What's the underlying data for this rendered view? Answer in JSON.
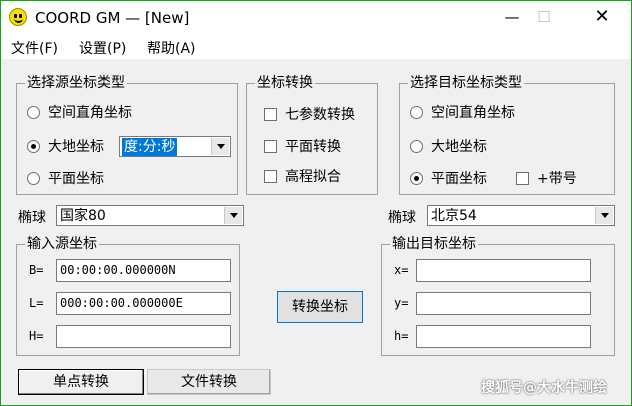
{
  "window": {
    "title": "COORD GM — [New]",
    "min": "—",
    "max": "☐",
    "close": "✕"
  },
  "menu": [
    "文件(F)",
    "设置(P)",
    "帮助(A)"
  ],
  "source_type": {
    "title": "选择源坐标类型",
    "options": [
      "空间直角坐标",
      "大地坐标",
      "平面坐标"
    ],
    "selected": "大地坐标",
    "format_value": "度:分:秒"
  },
  "conversion": {
    "title": "坐标转换",
    "options": [
      "七参数转换",
      "平面转换",
      "高程拟合"
    ]
  },
  "target_type": {
    "title": "选择目标坐标类型",
    "options": [
      "空间直角坐标",
      "大地坐标",
      "平面坐标"
    ],
    "selected": "平面坐标",
    "band_label": "+带号"
  },
  "ellipsoid": {
    "label": "椭球",
    "source_value": "国家80",
    "target_value": "北京54"
  },
  "input_coords": {
    "title": "输入源坐标",
    "labels": [
      "B=",
      "L=",
      "H="
    ],
    "values": [
      "00:00:00.000000N",
      "000:00:00.000000E",
      ""
    ]
  },
  "output_coords": {
    "title": "输出目标坐标",
    "labels": [
      "x=",
      "y=",
      "h="
    ],
    "values": [
      "",
      "",
      ""
    ]
  },
  "convert_button": "转换坐标",
  "tabs": [
    "单点转换",
    "文件转换"
  ],
  "watermark": "搜狐号@大水牛测绘",
  "colors": {
    "selection": "#0078d7",
    "border_accent": "#1aa31a"
  }
}
